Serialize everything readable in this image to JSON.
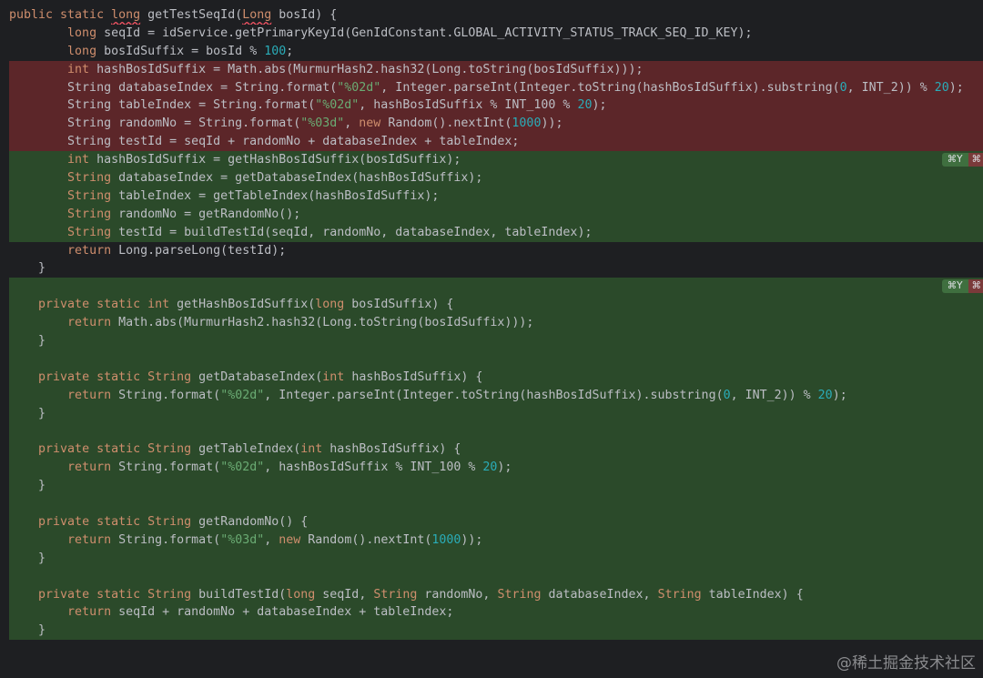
{
  "lines": [
    {
      "kind": "ctx",
      "html": "<span class=\"kw\">public static</span> <span class=\"ty sq\">long</span> getTestSeqId(<span class=\"ty sq\">Long</span> bosId) {"
    },
    {
      "kind": "ctx",
      "html": "        <span class=\"ty\">long</span> seqId = idService.getPrimaryKeyId(GenIdConstant.GLOBAL_ACTIVITY_STATUS_TRACK_SEQ_ID_KEY);"
    },
    {
      "kind": "ctx",
      "html": "        <span class=\"ty\">long</span> bosIdSuffix = bosId % <span class=\"num\">100</span>;"
    },
    {
      "kind": "del",
      "html": "        <span class=\"ty\">int</span> hashBosIdSuffix = Math.abs(MurmurHash2.hash32(Long.toString(bosIdSuffix)));"
    },
    {
      "kind": "del",
      "html": "        String databaseIndex = String.format(<span class=\"str\">\"%02d\"</span>, Integer.parseInt(Integer.toString(hashBosIdSuffix).substring(<span class=\"num\">0</span>, INT_2)) % <span class=\"num\">20</span>);"
    },
    {
      "kind": "del",
      "html": "        String tableIndex = String.format(<span class=\"str\">\"%02d\"</span>, hashBosIdSuffix % INT_100 % <span class=\"num\">20</span>);"
    },
    {
      "kind": "del",
      "html": "        String randomNo = String.format(<span class=\"str\">\"%03d\"</span>, <span class=\"kw\">new</span> Random().nextInt(<span class=\"num\">1000</span>));"
    },
    {
      "kind": "del",
      "html": "        String testId = seqId + randomNo + databaseIndex + tableIndex;"
    },
    {
      "kind": "add",
      "gutter": true,
      "html": "        <span class=\"ty\">int</span> hashBosIdSuffix = getHashBosIdSuffix(bosIdSuffix);"
    },
    {
      "kind": "add",
      "html": "        <span class=\"ty\">String</span> databaseIndex = getDatabaseIndex(hashBosIdSuffix);"
    },
    {
      "kind": "add",
      "html": "        <span class=\"ty\">String</span> tableIndex = getTableIndex(hashBosIdSuffix);"
    },
    {
      "kind": "add",
      "html": "        <span class=\"ty\">String</span> randomNo = getRandomNo();"
    },
    {
      "kind": "add",
      "html": "        <span class=\"ty\">String</span> testId = buildTestId(seqId, randomNo, databaseIndex, tableIndex);"
    },
    {
      "kind": "ctx",
      "html": "        <span class=\"kw\">return</span> Long.parseLong(testId);"
    },
    {
      "kind": "ctx",
      "html": "    }"
    },
    {
      "kind": "add",
      "gutter": true,
      "html": ""
    },
    {
      "kind": "add",
      "html": "    <span class=\"kw\">private static</span> <span class=\"ty\">int</span> getHashBosIdSuffix(<span class=\"ty\">long</span> bosIdSuffix) {"
    },
    {
      "kind": "add",
      "html": "        <span class=\"kw\">return</span> Math.abs(MurmurHash2.hash32(Long.toString(bosIdSuffix)));"
    },
    {
      "kind": "add",
      "html": "    }"
    },
    {
      "kind": "add",
      "html": ""
    },
    {
      "kind": "add",
      "html": "    <span class=\"kw\">private static</span> <span class=\"ty\">String</span> getDatabaseIndex(<span class=\"ty\">int</span> hashBosIdSuffix) {"
    },
    {
      "kind": "add",
      "html": "        <span class=\"kw\">return</span> String.format(<span class=\"str\">\"%02d\"</span>, Integer.parseInt(Integer.toString(hashBosIdSuffix).substring(<span class=\"num\">0</span>, INT_2)) % <span class=\"num\">20</span>);"
    },
    {
      "kind": "add",
      "html": "    }"
    },
    {
      "kind": "add",
      "html": ""
    },
    {
      "kind": "add",
      "html": "    <span class=\"kw\">private static</span> <span class=\"ty\">String</span> getTableIndex(<span class=\"ty\">int</span> hashBosIdSuffix) {"
    },
    {
      "kind": "add",
      "html": "        <span class=\"kw\">return</span> String.format(<span class=\"str\">\"%02d\"</span>, hashBosIdSuffix % INT_100 % <span class=\"num\">20</span>);"
    },
    {
      "kind": "add",
      "html": "    }"
    },
    {
      "kind": "add",
      "html": ""
    },
    {
      "kind": "add",
      "html": "    <span class=\"kw\">private static</span> <span class=\"ty\">String</span> getRandomNo() {"
    },
    {
      "kind": "add",
      "html": "        <span class=\"kw\">return</span> String.format(<span class=\"str\">\"%03d\"</span>, <span class=\"kw\">new</span> Random().nextInt(<span class=\"num\">1000</span>));"
    },
    {
      "kind": "add",
      "html": "    }"
    },
    {
      "kind": "add",
      "html": ""
    },
    {
      "kind": "add",
      "html": "    <span class=\"kw\">private static</span> <span class=\"ty\">String</span> buildTestId(<span class=\"ty\">long</span> seqId, <span class=\"ty\">String</span> randomNo, <span class=\"ty\">String</span> databaseIndex, <span class=\"ty\">String</span> tableIndex) {"
    },
    {
      "kind": "add",
      "html": "        <span class=\"kw\">return</span> seqId + randomNo + databaseIndex + tableIndex;"
    },
    {
      "kind": "add",
      "html": "    }"
    }
  ],
  "gutter": {
    "accept_label": "⌘Y",
    "reject_label": "⌘"
  },
  "watermark": "@稀土掘金技术社区",
  "colors": {
    "deleted_bg": "#5c2629",
    "added_bg": "#2b4a2a",
    "editor_bg": "#1e1f22",
    "keyword": "#cf8e6d",
    "string": "#6aab73",
    "number": "#2aacb8"
  }
}
